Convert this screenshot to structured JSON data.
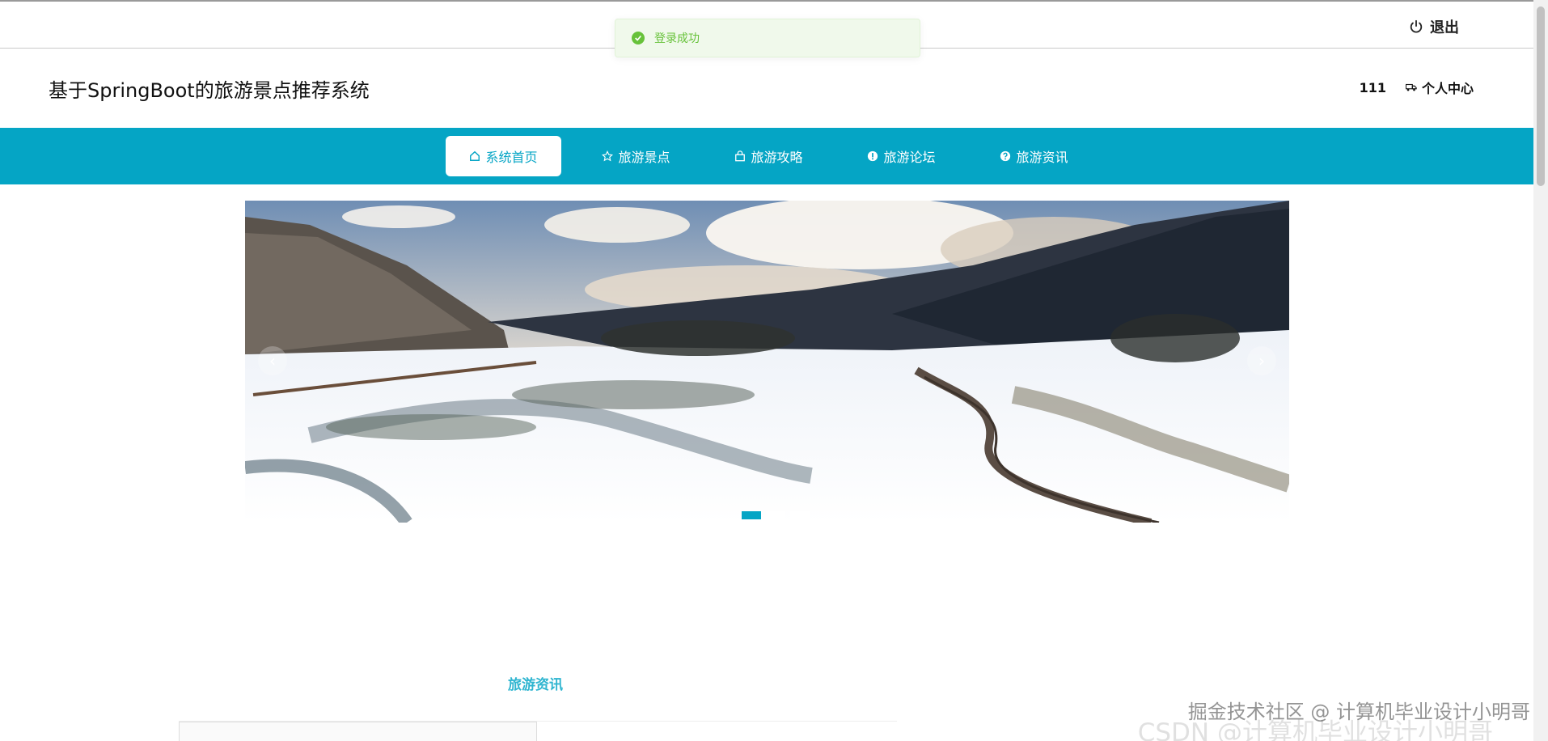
{
  "toast": {
    "message": "登录成功",
    "color": "#67c23a"
  },
  "topbar": {
    "logout_label": "退出"
  },
  "header": {
    "site_title": "基于SpringBoot的旅游景点推荐系统",
    "username": "111",
    "personal_center": "个人中心"
  },
  "nav": {
    "accent": "#05a5c5",
    "items": [
      {
        "label": "系统首页",
        "icon": "home-icon"
      },
      {
        "label": "旅游景点",
        "icon": "star-icon"
      },
      {
        "label": "旅游攻略",
        "icon": "bag-icon"
      },
      {
        "label": "旅游论坛",
        "icon": "alert-circle-icon"
      },
      {
        "label": "旅游资讯",
        "icon": "question-circle-icon"
      }
    ]
  },
  "banner": {
    "prev": "‹",
    "next": "›",
    "slides": 3,
    "active_slide": 1
  },
  "news": {
    "title": "旅游资讯"
  },
  "watermark": {
    "line1": "掘金技术社区 @ 计算机毕业设计小明哥",
    "line2": "CSDN @计算机毕业设计小明哥"
  }
}
